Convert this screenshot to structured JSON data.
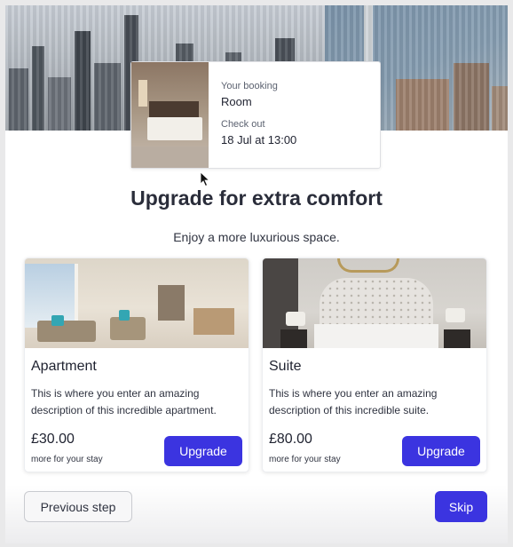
{
  "booking": {
    "label_booking": "Your booking",
    "room_type": "Room",
    "label_checkout": "Check out",
    "checkout_value": "18 Jul at 13:00"
  },
  "header": {
    "title": "Upgrade for extra comfort",
    "subtitle": "Enjoy a more luxurious space."
  },
  "options": [
    {
      "name": "Apartment",
      "description": "This is where you enter an amazing description of this incredible apartment.",
      "price": "£30.00",
      "price_note": "more for your stay",
      "button": "Upgrade"
    },
    {
      "name": "Suite",
      "description": "This is where you enter an amazing description of this incredible suite.",
      "price": "£80.00",
      "price_note": "more for your stay",
      "button": "Upgrade"
    }
  ],
  "footer": {
    "previous": "Previous step",
    "skip": "Skip"
  },
  "colors": {
    "accent": "#3b34e0",
    "background": "#ffffff"
  }
}
